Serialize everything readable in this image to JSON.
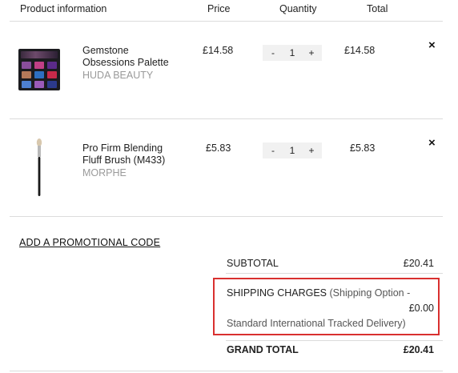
{
  "header": {
    "product_information": "Product information",
    "price": "Price",
    "quantity": "Quantity",
    "total": "Total"
  },
  "items": [
    {
      "name_line1": "Gemstone",
      "name_line2": "Obsessions Palette",
      "brand": "HUDA BEAUTY",
      "price": "£14.58",
      "qty_minus": "-",
      "qty": "1",
      "qty_plus": "+",
      "total": "£14.58",
      "remove": "×"
    },
    {
      "name_line1": "Pro Firm Blending",
      "name_line2": "Fluff Brush (M433)",
      "brand": "MORPHE",
      "price": "£5.83",
      "qty_minus": "-",
      "qty": "1",
      "qty_plus": "+",
      "total": "£5.83",
      "remove": "×"
    }
  ],
  "promo": {
    "label": "ADD A PROMOTIONAL CODE"
  },
  "summary": {
    "subtotal_label": "SUBTOTAL",
    "subtotal_value": "£20.41",
    "shipping_label": "SHIPPING CHARGES",
    "shipping_option_line1": "(Shipping Option -",
    "shipping_option_line2": "Standard International Tracked Delivery)",
    "shipping_value": "£0.00",
    "grand_total_label": "GRAND TOTAL",
    "grand_total_value": "£20.41"
  },
  "colors": {
    "highlight_border": "#d9302f",
    "brand_text": "#9a9a9a",
    "qty_bg": "#f1f1f1"
  }
}
